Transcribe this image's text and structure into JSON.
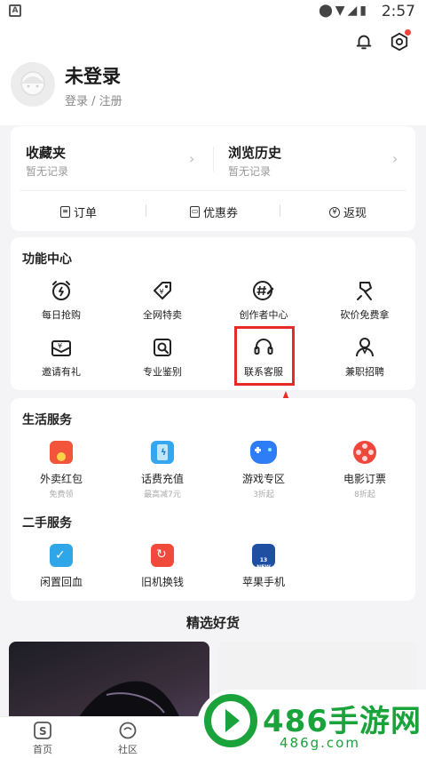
{
  "status_bar": {
    "time": "2:57"
  },
  "profile": {
    "name": "未登录",
    "login_link": "登录 / 注册"
  },
  "records": {
    "favorites": {
      "title": "收藏夹",
      "subtitle": "暂无记录"
    },
    "history": {
      "title": "浏览历史",
      "subtitle": "暂无记录"
    }
  },
  "quick_links": [
    "订单",
    "优惠券",
    "返现"
  ],
  "function_center": {
    "title": "功能中心",
    "items": [
      {
        "label": "每日抢购",
        "icon": "alarm-clock-icon"
      },
      {
        "label": "全网特卖",
        "icon": "price-tag-icon"
      },
      {
        "label": "创作者中心",
        "icon": "hashtag-pen-icon"
      },
      {
        "label": "砍价免费拿",
        "icon": "axe-icon"
      },
      {
        "label": "邀请有礼",
        "icon": "envelope-yen-icon"
      },
      {
        "label": "专业鉴别",
        "icon": "magnifier-icon"
      },
      {
        "label": "联系客服",
        "icon": "headset-icon"
      },
      {
        "label": "兼职招聘",
        "icon": "person-icon"
      }
    ]
  },
  "life_services": {
    "title": "生活服务",
    "items": [
      {
        "label": "外卖红包",
        "sub": "免费领",
        "icon": "red-packet-icon",
        "color": "#f2553b"
      },
      {
        "label": "话费充值",
        "sub": "最高减7元",
        "icon": "phone-charge-icon",
        "color": "#35a6f0"
      },
      {
        "label": "游戏专区",
        "sub": "3折起",
        "icon": "gamepad-icon",
        "color": "#2f7df6"
      },
      {
        "label": "电影订票",
        "sub": "8折起",
        "icon": "film-reel-icon",
        "color": "#f0473d"
      }
    ]
  },
  "second_hand": {
    "title": "二手服务",
    "items": [
      {
        "label": "闲置回血",
        "icon": "recycle-box-icon",
        "color": "#2fa6e8"
      },
      {
        "label": "旧机换钱",
        "icon": "phone-swap-icon",
        "color": "#f04a3a"
      },
      {
        "label": "苹果手机",
        "icon": "iphone-icon",
        "color": "#1f4fa0",
        "badge": "13 NEW"
      }
    ]
  },
  "featured": {
    "title": "精选好货"
  },
  "tabs": [
    "首页",
    "社区"
  ],
  "watermark": {
    "text": "486手游网",
    "url": "486g.com"
  },
  "colors": {
    "highlight": "#e52b26",
    "watermark": "#1aa33b"
  }
}
